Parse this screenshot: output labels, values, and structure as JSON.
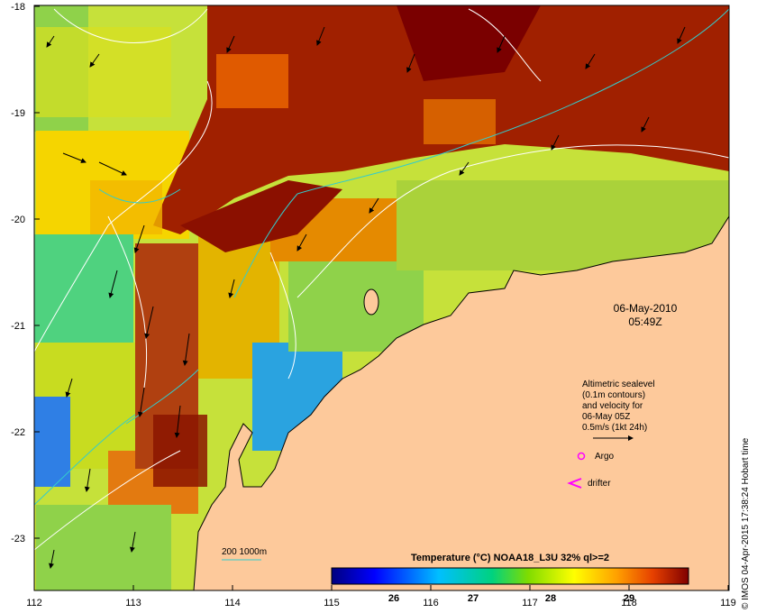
{
  "map": {
    "x_ticks": [
      "112",
      "113",
      "114",
      "115",
      "116",
      "117",
      "118",
      "119"
    ],
    "y_ticks": [
      "-18",
      "-19",
      "-20",
      "-21",
      "-22",
      "-23"
    ],
    "datetime": {
      "date": "06-May-2010",
      "time": "05:49Z"
    },
    "legend": {
      "line1": "Altimetric sealevel",
      "line2": "(0.1m contours)",
      "line3": "and velocity for",
      "line4": "06-May 05Z",
      "line5": "0.5m/s (1kt 24h)",
      "argo": "Argo",
      "drifter": "drifter"
    },
    "depth_label": "200  1000m",
    "colorbar": {
      "title": "Temperature (°C) NOAA18_L3U 32% ql>=2",
      "ticks": [
        "26",
        "27",
        "28",
        "29"
      ]
    },
    "credit": "© IMOS 04-Apr-2015 17:38:24 Hobart time",
    "colors": {
      "land": "#fdc99b",
      "contour": "#ffffff",
      "isobath": "#33cccc",
      "arrow": "#000000",
      "argo": "#ff00ff",
      "drifter": "#ff00ff"
    }
  }
}
